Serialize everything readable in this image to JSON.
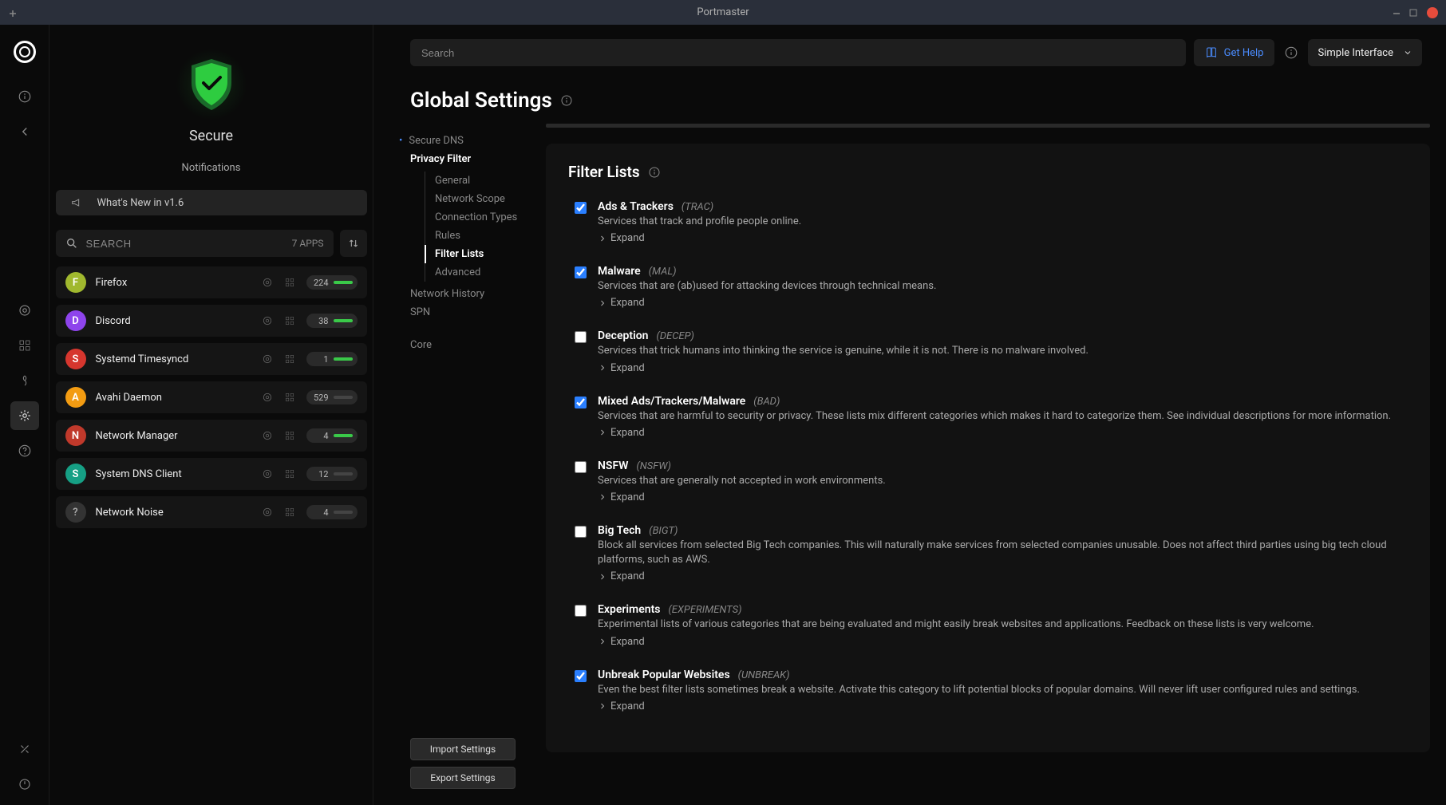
{
  "titlebar": {
    "title": "Portmaster"
  },
  "sidebar": {
    "secure_label": "Secure",
    "notifications_label": "Notifications",
    "whatsnew": "What's New in v1.6",
    "search_placeholder": "SEARCH",
    "app_count_label": "7 APPS",
    "apps": [
      {
        "letter": "F",
        "name": "Firefox",
        "count": "224",
        "color": "#a0b82e",
        "bar_green": true
      },
      {
        "letter": "D",
        "name": "Discord",
        "count": "38",
        "color": "#8e44ec",
        "bar_green": true
      },
      {
        "letter": "S",
        "name": "Systemd Timesyncd",
        "count": "1",
        "color": "#d6362e",
        "bar_green": true
      },
      {
        "letter": "A",
        "name": "Avahi Daemon",
        "count": "529",
        "color": "#f39c12",
        "bar_green": false
      },
      {
        "letter": "N",
        "name": "Network Manager",
        "count": "4",
        "color": "#c0392b",
        "bar_green": true
      },
      {
        "letter": "S",
        "name": "System DNS Client",
        "count": "12",
        "color": "#16a085",
        "bar_green": false
      },
      {
        "letter": "?",
        "name": "Network Noise",
        "count": "4",
        "color": "#333333",
        "bar_green": false
      }
    ]
  },
  "toolbar": {
    "search_placeholder": "Search",
    "gethelp": "Get Help",
    "interface_mode": "Simple Interface"
  },
  "page": {
    "title": "Global Settings"
  },
  "nav": {
    "secure_dns": "Secure DNS",
    "privacy_filter": "Privacy Filter",
    "sub": {
      "general": "General",
      "network_scope": "Network Scope",
      "connection_types": "Connection Types",
      "rules": "Rules",
      "filter_lists": "Filter Lists",
      "advanced": "Advanced"
    },
    "network_history": "Network History",
    "spn": "SPN",
    "core": "Core",
    "import_btn": "Import Settings",
    "export_btn": "Export Settings"
  },
  "panel": {
    "title": "Filter Lists",
    "expand_label": "Expand",
    "items": [
      {
        "name": "Ads & Trackers",
        "code": "(TRAC)",
        "desc": "Services that track and profile people online.",
        "checked": true
      },
      {
        "name": "Malware",
        "code": "(MAL)",
        "desc": "Services that are (ab)used for attacking devices through technical means.",
        "checked": true
      },
      {
        "name": "Deception",
        "code": "(DECEP)",
        "desc": "Services that trick humans into thinking the service is genuine, while it is not. There is no malware involved.",
        "checked": false
      },
      {
        "name": "Mixed Ads/Trackers/Malware",
        "code": "(BAD)",
        "desc": "Services that are harmful to security or privacy. These lists mix different categories which makes it hard to categorize them. See individual descriptions for more information.",
        "checked": true
      },
      {
        "name": "NSFW",
        "code": "(NSFW)",
        "desc": "Services that are generally not accepted in work environments.",
        "checked": false
      },
      {
        "name": "Big Tech",
        "code": "(BIGT)",
        "desc": "Block all services from selected Big Tech companies. This will naturally make services from selected companies unusable. Does not affect third parties using big tech cloud platforms, such as AWS.",
        "checked": false
      },
      {
        "name": "Experiments",
        "code": "(EXPERIMENTS)",
        "desc": "Experimental lists of various categories that are being evaluated and might easily break websites and applications. Feedback on these lists is very welcome.",
        "checked": false
      },
      {
        "name": "Unbreak Popular Websites",
        "code": "(UNBREAK)",
        "desc": "Even the best filter lists sometimes break a website. Activate this category to lift potential blocks of popular domains. Will never lift user configured rules and settings.",
        "checked": true
      }
    ]
  }
}
